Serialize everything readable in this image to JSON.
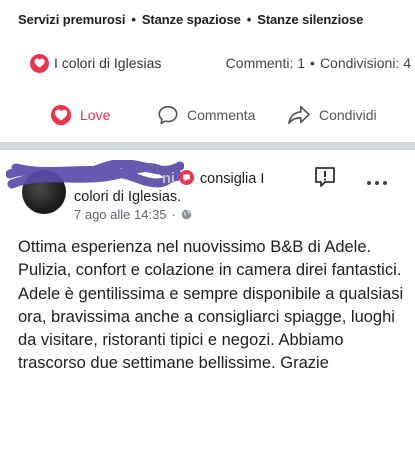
{
  "top_features": [
    "Servizi premurosi",
    "Stanze spaziose",
    "Stanze silenziose"
  ],
  "stats": {
    "page_name": "I colori di Iglesias",
    "comments": "Commenti: 1",
    "shares": "Condivisioni: 4",
    "separator": "•"
  },
  "actions": {
    "love": "Love",
    "comment": "Commenta",
    "share": "Condividi"
  },
  "post": {
    "author_visible": "ni",
    "recommends": "consiglia I",
    "page_name": "colori di Iglesias.",
    "timestamp": "7 ago alle 14:35",
    "privacy_separator": "·",
    "body": "Ottima esperienza nel nuovissimo B&B di Adele. Pulizia, confort e colazione in camera direi fantastici. Adele è gentilissima e sempre disponibile a qualsiasi ora, bravissima anche a consigliarci spiagge, luoghi da visitare, ristoranti tipici  e negozi. Abbiamo trascorso due settimane bellissime. Grazie"
  },
  "colors": {
    "love_red": "#e8364f",
    "divider": "#d4d7dc",
    "scribble": "#5b4aa8"
  },
  "icons": [
    "heart-icon",
    "comment-icon",
    "share-icon",
    "recommend-icon",
    "flag-icon",
    "more-icon",
    "globe-icon"
  ]
}
